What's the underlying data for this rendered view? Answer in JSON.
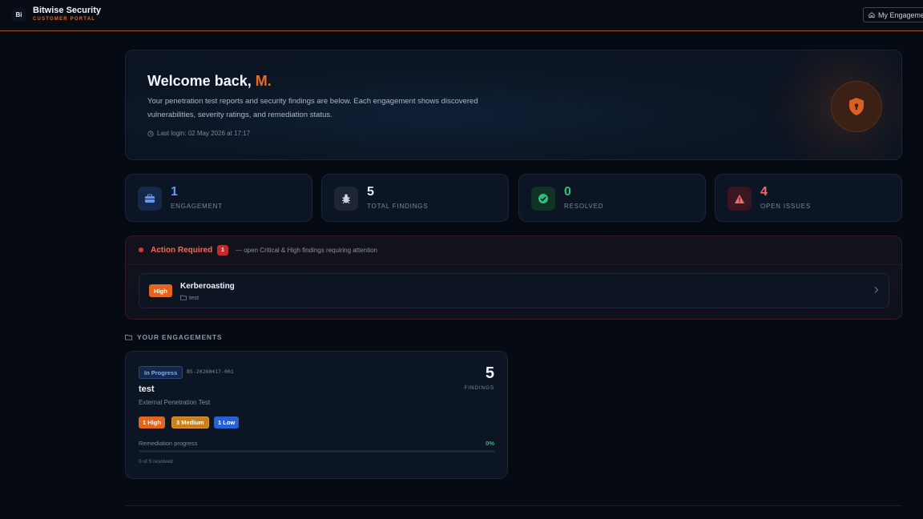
{
  "header": {
    "logo_text": "Bi",
    "brand_name": "Bitwise Security",
    "brand_sub": "CUSTOMER PORTAL",
    "nav_button_label": "My Engagements",
    "accent_color": "#e36a2c"
  },
  "welcome": {
    "greeting": "Welcome back,",
    "user_name": "M.",
    "description": "Your penetration test reports and security findings are below. Each engagement shows discovered vulnerabilities, severity ratings, and remediation status.",
    "last_login": "Last login: 02 May 2026 at 17:17",
    "icon": "shield-lock-icon"
  },
  "stats": [
    {
      "value": "1",
      "label": "ENGAGEMENT",
      "icon": "briefcase-icon",
      "color": "#5b9cf0"
    },
    {
      "value": "5",
      "label": "TOTAL FINDINGS",
      "icon": "bug-icon",
      "color": "#e8edf5"
    },
    {
      "value": "0",
      "label": "RESOLVED",
      "icon": "check-circle-icon",
      "color": "#2fbf7a"
    },
    {
      "value": "4",
      "label": "OPEN ISSUES",
      "icon": "warning-icon",
      "color": "#f26b6b"
    }
  ],
  "action_required": {
    "title": "Action Required",
    "count": "1",
    "description": "— open Critical & High findings requiring attention",
    "findings": [
      {
        "severity": "High",
        "title": "Kerberoasting",
        "engagement": "test"
      }
    ]
  },
  "engagements_section": {
    "label": "YOUR ENGAGEMENTS",
    "items": [
      {
        "status": "In Progress",
        "id": "BS-20260417-001",
        "name": "test",
        "type": "External Penetration Test",
        "findings_count": "5",
        "findings_label": "FINDINGS",
        "severity_pills": [
          "1 High",
          "3 Medium",
          "1 Low"
        ],
        "progress_label": "Remediation progress",
        "progress_pct": "0%",
        "progress_value": 0,
        "resolved_text": "0 of 5 resolved"
      }
    ]
  }
}
